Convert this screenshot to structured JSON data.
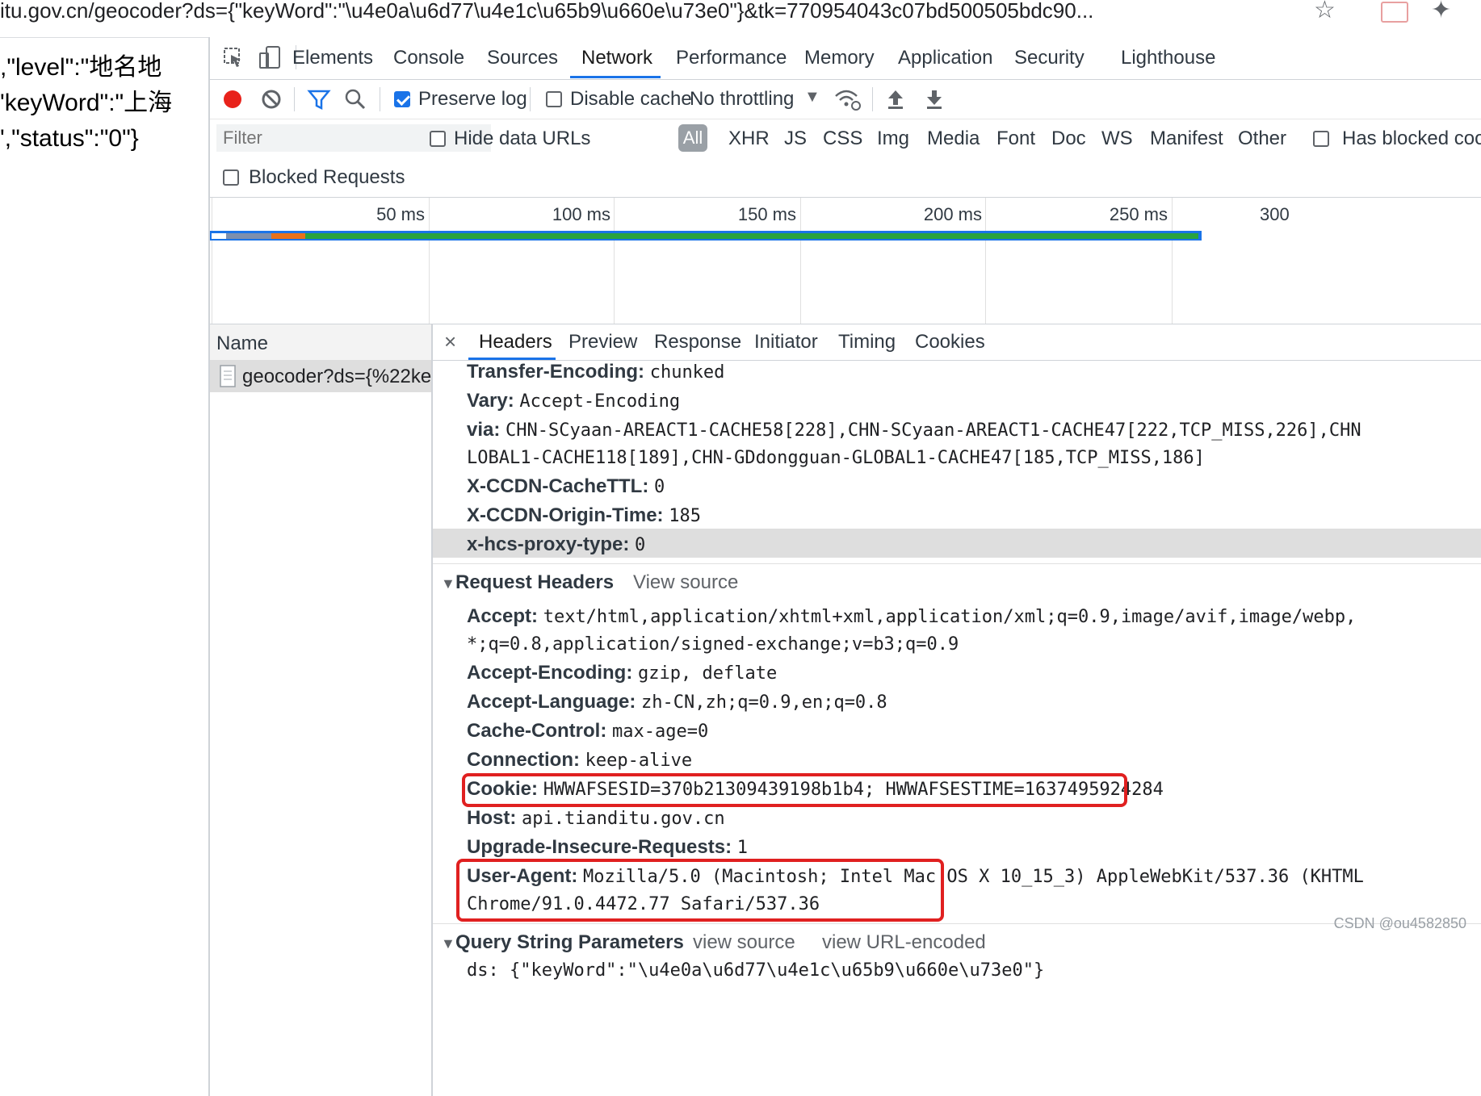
{
  "browser": {
    "url": "itu.gov.cn/geocoder?ds={\"keyWord\":\"\\u4e0a\\u6d77\\u4e1c\\u65b9\\u660e\\u73e0\"}&tk=770954043c07bd500505bdc90..."
  },
  "page": {
    "line1": ",\"level\":\"地名地",
    "line2": "'keyWord\":\"上海",
    "line3": "',\"status\":\"0\"}"
  },
  "devtools": {
    "tabs": [
      "Elements",
      "Console",
      "Sources",
      "Network",
      "Performance",
      "Memory",
      "Application",
      "Security",
      "Lighthouse"
    ],
    "active_tab": "Network",
    "toolbar": {
      "preserve_log": "Preserve log",
      "disable_cache": "Disable cache",
      "throttling": "No throttling"
    },
    "filter": {
      "placeholder": "Filter",
      "hide_data_urls": "Hide data URLs",
      "all": "All",
      "types": [
        "XHR",
        "JS",
        "CSS",
        "Img",
        "Media",
        "Font",
        "Doc",
        "WS",
        "Manifest",
        "Other"
      ],
      "has_blocked": "Has blocked coo",
      "blocked_requests": "Blocked Requests"
    },
    "timeline": {
      "ticks": [
        "50 ms",
        "100 ms",
        "150 ms",
        "200 ms",
        "250 ms",
        "300"
      ]
    },
    "requests": {
      "name_header": "Name",
      "items": [
        "geocoder?ds={%22ke..."
      ]
    },
    "detail": {
      "tabs": [
        "Headers",
        "Preview",
        "Response",
        "Initiator",
        "Timing",
        "Cookies"
      ],
      "active_tab": "Headers",
      "close": "×",
      "response_headers": [
        {
          "name": "Transfer-Encoding:",
          "value": "chunked"
        },
        {
          "name": "Vary:",
          "value": "Accept-Encoding"
        },
        {
          "name": "via:",
          "value": "CHN-SCyaan-AREACT1-CACHE58[228],CHN-SCyaan-AREACT1-CACHE47[222,TCP_MISS,226],CHN"
        },
        {
          "name": "",
          "value": "LOBAL1-CACHE118[189],CHN-GDdongguan-GLOBAL1-CACHE47[185,TCP_MISS,186]"
        },
        {
          "name": "X-CCDN-CacheTTL:",
          "value": "0"
        },
        {
          "name": "X-CCDN-Origin-Time:",
          "value": "185"
        },
        {
          "name": "x-hcs-proxy-type:",
          "value": "0"
        }
      ],
      "request_headers_title": "Request Headers",
      "request_view_source": "View source",
      "request_headers": [
        {
          "name": "Accept:",
          "value": "text/html,application/xhtml+xml,application/xml;q=0.9,image/avif,image/webp,"
        },
        {
          "name": "",
          "value": "*;q=0.8,application/signed-exchange;v=b3;q=0.9"
        },
        {
          "name": "Accept-Encoding:",
          "value": "gzip, deflate"
        },
        {
          "name": "Accept-Language:",
          "value": "zh-CN,zh;q=0.9,en;q=0.8"
        },
        {
          "name": "Cache-Control:",
          "value": "max-age=0"
        },
        {
          "name": "Connection:",
          "value": "keep-alive"
        },
        {
          "name": "Cookie:",
          "value": "HWWAFSESID=370b21309439198b1b4; HWWAFSESTIME=1637495924284"
        },
        {
          "name": "Host:",
          "value": "api.tianditu.gov.cn"
        },
        {
          "name": "Upgrade-Insecure-Requests:",
          "value": "1"
        },
        {
          "name": "User-Agent:",
          "value": "Mozilla/5.0 (Macintosh; Intel Mac OS X 10_15_3) AppleWebKit/537.36 (KHTML"
        },
        {
          "name": "",
          "value": "Chrome/91.0.4472.77 Safari/537.36"
        }
      ],
      "query_title": "Query String Parameters",
      "query_view_source": "view source",
      "query_view_url": "view URL-encoded",
      "query_first": "ds: {\"keyWord\":\"\\u4e0a\\u6d77\\u4e1c\\u65b9\\u660e\\u73e0\"}"
    }
  },
  "watermark": "CSDN @ou4582850"
}
